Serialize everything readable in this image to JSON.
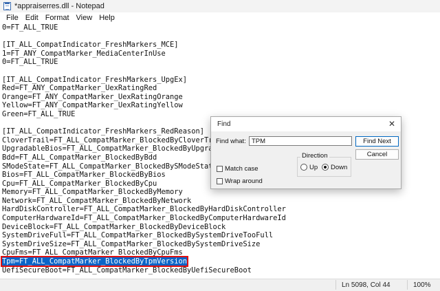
{
  "window": {
    "title": "*appraiserres.dll - Notepad"
  },
  "menu": [
    "File",
    "Edit",
    "Format",
    "View",
    "Help"
  ],
  "lines": [
    "0=FT_ALL_TRUE",
    "",
    "[IT_ALL_CompatIndicator_FreshMarkers_MCE]",
    "1=FT_ANY_CompatMarker_MediaCenterInUse",
    "0=FT_ALL_TRUE",
    "",
    "[IT_ALL_CompatIndicator_FreshMarkers_UpgEx]",
    "Red=FT_ANY_CompatMarker_UexRatingRed",
    "Orange=FT_ANY_CompatMarker_UexRatingOrange",
    "Yellow=FT_ANY_CompatMarker_UexRatingYellow",
    "Green=FT_ALL_TRUE",
    "",
    "[IT_ALL_CompatIndicator_FreshMarkers_RedReason]",
    "CloverTrail=FT_ALL_CompatMarker_BlockedByCloverTrail",
    "UpgradableBios=FT_ALL_CompatMarker_BlockedByUpgradableBios",
    "Bdd=FT_ALL_CompatMarker_BlockedByBdd",
    "SModeState=FT_ALL_CompatMarker_BlockedBySModeState",
    "Bios=FT_ALL_CompatMarker_BlockedByBios",
    "Cpu=FT_ALL_CompatMarker_BlockedByCpu",
    "Memory=FT_ALL_CompatMarker_BlockedByMemory",
    "Network=FT_ALL_CompatMarker_BlockedByNetwork",
    "HardDiskController=FT_ALL_CompatMarker_BlockedByHardDiskController",
    "ComputerHardwareId=FT_ALL_CompatMarker_BlockedByComputerHardwareId",
    "DeviceBlock=FT_ALL_CompatMarker_BlockedByDeviceBlock",
    "SystemDriveFull=FT_ALL_CompatMarker_BlockedBySystemDriveTooFull",
    "SystemDriveSize=FT_ALL_CompatMarker_BlockedBySystemDriveSize",
    "CpuFms=FT_ALL_CompatMarker_BlockedByCpuFms"
  ],
  "selected_line": "Tpm=FT_ALL_CompatMarker_BlockedByTpmVersion",
  "after_line": "UefiSecureBoot=FT_ALL_CompatMarker_BlockedByUefiSecureBoot",
  "status": {
    "position": "Ln 5098, Col 44",
    "zoom": "100%"
  },
  "find": {
    "title": "Find",
    "close_icon": "close-icon",
    "find_what_label": "Find what:",
    "find_what_value": "TPM",
    "find_next_label": "Find Next",
    "cancel_label": "Cancel",
    "direction_label": "Direction",
    "up_label": "Up",
    "down_label": "Down",
    "direction_selected": "Down",
    "match_case_label": "Match case",
    "match_case_checked": false,
    "wrap_around_label": "Wrap around",
    "wrap_around_checked": false
  },
  "colors": {
    "selection": "#0a64c8",
    "highlight_box": "#e01010",
    "button_accent": "#0067c0"
  }
}
